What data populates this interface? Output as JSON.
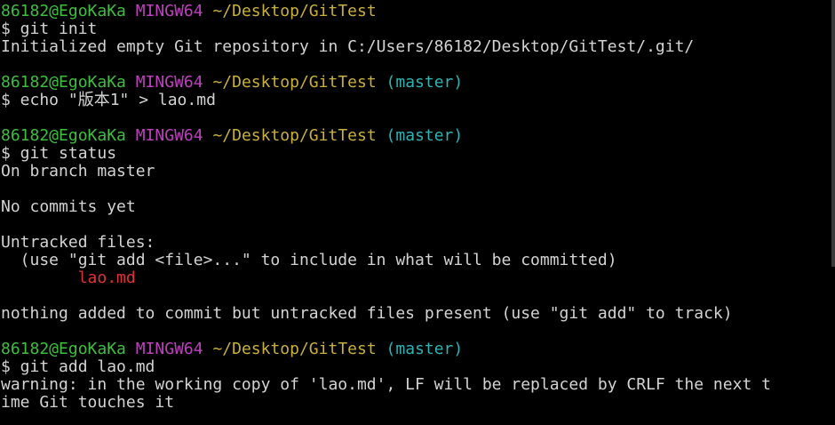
{
  "prompt": {
    "user": "86182@EgoKaKa",
    "system": "MINGW64",
    "path": "~/Desktop/GitTest",
    "branch": "(master)"
  },
  "blocks": [
    {
      "cmd": "$ git init",
      "output": [
        "Initialized empty Git repository in C:/Users/86182/Desktop/GitTest/.git/"
      ]
    },
    {
      "cmd": "$ echo \"版本1\" > lao.md",
      "output": []
    },
    {
      "cmd": "$ git status",
      "output": [
        "On branch master",
        "",
        "No commits yet",
        "",
        "Untracked files:",
        "  (use \"git add <file>...\" to include in what will be committed)"
      ],
      "untracked_file": "        lao.md",
      "output_after": [
        "",
        "nothing added to commit but untracked files present (use \"git add\" to track)"
      ]
    },
    {
      "cmd": "$ git add lao.md",
      "output": [
        "warning: in the working copy of 'lao.md', LF will be replaced by CRLF the next t",
        "ime Git touches it"
      ]
    }
  ]
}
